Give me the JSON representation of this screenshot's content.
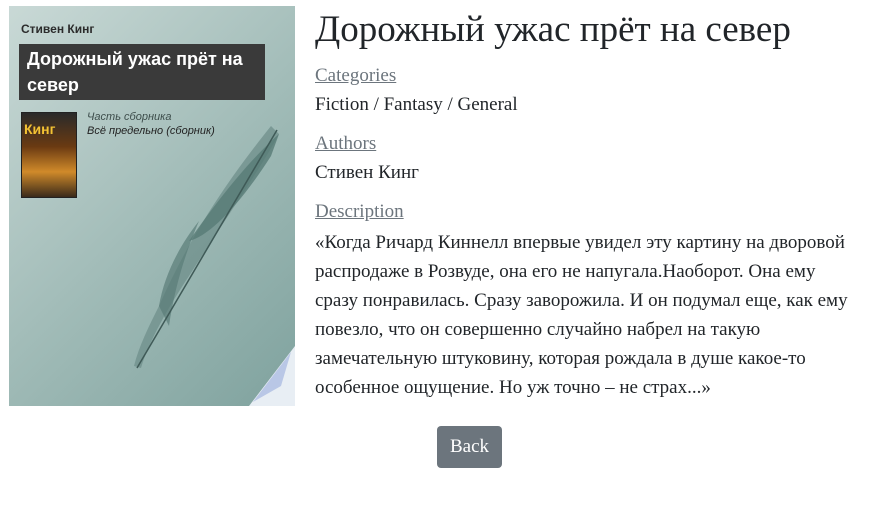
{
  "book": {
    "title": "Дорожный ужас прёт на север",
    "categories_label": "Categories",
    "categories_value": "Fiction / Fantasy / General",
    "authors_label": "Authors",
    "authors_value": "Стивен Кинг",
    "description_label": "Description",
    "description_value": "«Когда Ричард Киннелл впервые увидел эту картину на дворовой распродаже в Розвуде, она его не напугала.Наоборот. Она ему сразу понравилась. Сразу заворожила. И он подумал еще, как ему повезло, что он совершенно случайно набрел на такую замечательную штуковину, которая рождала в душе какое-то особенное ощущение. Но уж точно – не страх...»"
  },
  "cover": {
    "author": "Стивен Кинг",
    "title": "Дорожный ужас прёт на север",
    "brand": "Кинг",
    "series_line1": "Часть сборника",
    "series_line2": "Всё предельно (сборник)"
  },
  "actions": {
    "back_label": "Back"
  }
}
